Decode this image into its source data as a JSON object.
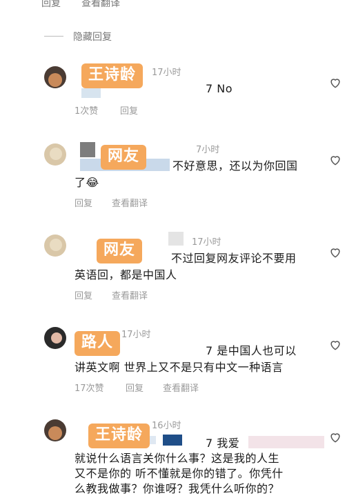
{
  "top": {
    "reply": "回复",
    "translate": "查看翻译"
  },
  "hidden_replies": "隐藏回复",
  "comments": [
    {
      "tag": "王诗龄",
      "time": "17小时",
      "text_lines": [
        "7 No"
      ],
      "likes": "1次赞",
      "reply": "回复"
    },
    {
      "tag": "网友",
      "time": "7小时",
      "text_lines": [
        "不好意思，还以为你回国",
        "了😂"
      ],
      "reply": "回复",
      "translate": "查看翻译"
    },
    {
      "tag": "网友",
      "time": "17小时",
      "text_lines": [
        "不过回复网友评论不要用",
        "英语回，都是中国人"
      ],
      "reply": "回复",
      "translate": "查看翻译"
    },
    {
      "tag": "路人",
      "time": "17小时",
      "text_lines": [
        "7 是中国人也可以",
        "讲英文啊 世界上又不是只有中文一种语言"
      ],
      "likes": "17次赞",
      "reply": "回复",
      "translate": "查看翻译"
    },
    {
      "tag": "王诗龄",
      "time": "16小时",
      "text_lines": [
        "7 我爱",
        "就说什么语言关你什么事？这是我的人生",
        "又不是你的 听不懂就是你的错了。你凭什",
        "么教我做事？你谁呀？我凭什么听你的？"
      ]
    }
  ]
}
